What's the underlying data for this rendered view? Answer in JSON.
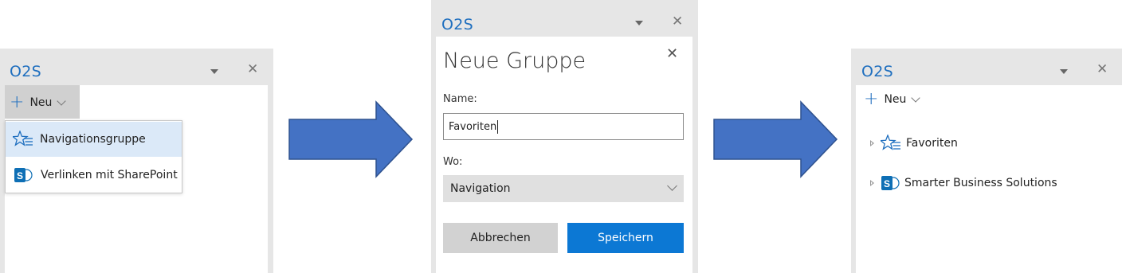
{
  "panel1": {
    "title": "O2S",
    "new_button": "Neu",
    "menu": [
      {
        "label": "Navigationsgruppe",
        "icon": "star-list-icon",
        "highlighted": true
      },
      {
        "label": "Verlinken mit SharePoint",
        "icon": "sharepoint-icon",
        "highlighted": false
      }
    ]
  },
  "panel2": {
    "title": "O2S",
    "dialog": {
      "heading": "Neue Gruppe",
      "name_label": "Name:",
      "name_value": "Favoriten",
      "where_label": "Wo:",
      "where_value": "Navigation",
      "cancel_label": "Abbrechen",
      "save_label": "Speichern"
    }
  },
  "panel3": {
    "title": "O2S",
    "new_button": "Neu",
    "tree": [
      {
        "label": "Favoriten",
        "icon": "star-list-icon"
      },
      {
        "label": "Smarter Business Solutions",
        "icon": "sharepoint-icon"
      }
    ]
  },
  "colors": {
    "accent": "#1f6fbf",
    "primary_button": "#0c78d4",
    "arrow_fill": "#4472c4",
    "arrow_stroke": "#2f528f",
    "highlight": "#dbe9f8",
    "panel_bg": "#e6e6e6"
  }
}
